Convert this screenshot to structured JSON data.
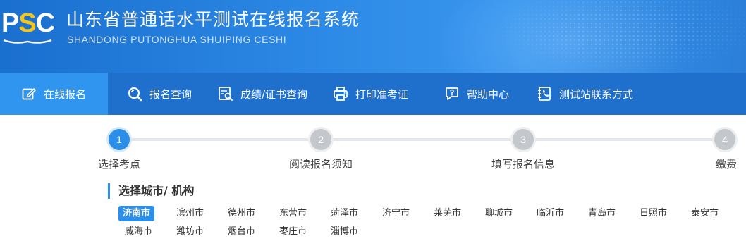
{
  "header": {
    "logo_text_p": "P",
    "logo_text_s": "S",
    "logo_text_c": "C",
    "title": "山东省普通话水平测试在线报名系统",
    "subtitle": "SHANDONG PUTONGHUA SHUIPING CESHI",
    "colors": {
      "banner": "#2d8ae6",
      "logo_accent": "#f5c518"
    }
  },
  "nav": {
    "items": [
      {
        "label": "在线报名",
        "icon": "edit-icon",
        "active": true
      },
      {
        "label": "报名查询",
        "icon": "search-icon",
        "active": false
      },
      {
        "label": "成绩/证书查询",
        "icon": "certificate-search-icon",
        "active": false
      },
      {
        "label": "打印准考证",
        "icon": "printer-icon",
        "active": false
      },
      {
        "label": "帮助中心",
        "icon": "help-chat-icon",
        "active": false
      },
      {
        "label": "测试站联系方式",
        "icon": "phone-book-icon",
        "active": false
      }
    ],
    "colors": {
      "bar": "#1f6fcd",
      "active": "#2f95ee"
    }
  },
  "steps": {
    "items": [
      {
        "number": "1",
        "label": "选择考点",
        "state": "active"
      },
      {
        "number": "2",
        "label": "阅读报名须知",
        "state": "todo"
      },
      {
        "number": "3",
        "label": "填写报名信息",
        "state": "todo"
      },
      {
        "number": "4",
        "label": "缴费",
        "state": "todo"
      }
    ],
    "colors": {
      "active": "#2b8fea",
      "todo": "#c4c7cb"
    }
  },
  "section": {
    "title": "选择城市/ 机构"
  },
  "cities": {
    "selected": "济南市",
    "items": [
      "济南市",
      "滨州市",
      "德州市",
      "东营市",
      "菏泽市",
      "济宁市",
      "莱芜市",
      "聊城市",
      "临沂市",
      "青岛市",
      "日照市",
      "泰安市",
      "威海市",
      "潍坊市",
      "烟台市",
      "枣庄市",
      "淄博市"
    ]
  }
}
